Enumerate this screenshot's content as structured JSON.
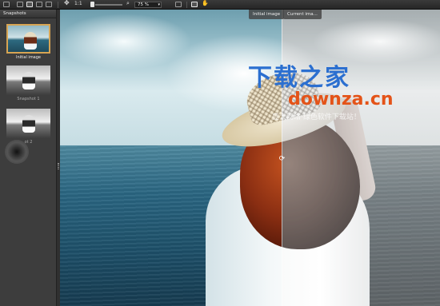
{
  "toolbar": {
    "ratio_label": "1:1",
    "zoom_value": "75 %"
  },
  "sidebar": {
    "title": "Snapshots",
    "snapshots": [
      {
        "label": "Initial image",
        "selected": true,
        "style": "color"
      },
      {
        "label": "Snapshot 1",
        "selected": false,
        "style": "bw"
      },
      {
        "label": "ot 2",
        "selected": false,
        "style": "bw"
      }
    ]
  },
  "canvas": {
    "left_tag": "Initial image",
    "right_tag": "Current ima..."
  },
  "watermark": {
    "logo": "下载之家",
    "url": "downza.cn",
    "slogan": "盛大网络·绿色软件下载站！"
  },
  "colors": {
    "selection_border": "#d7a453",
    "watermark_blue": "#2b6fd0",
    "watermark_orange": "#e45318"
  }
}
